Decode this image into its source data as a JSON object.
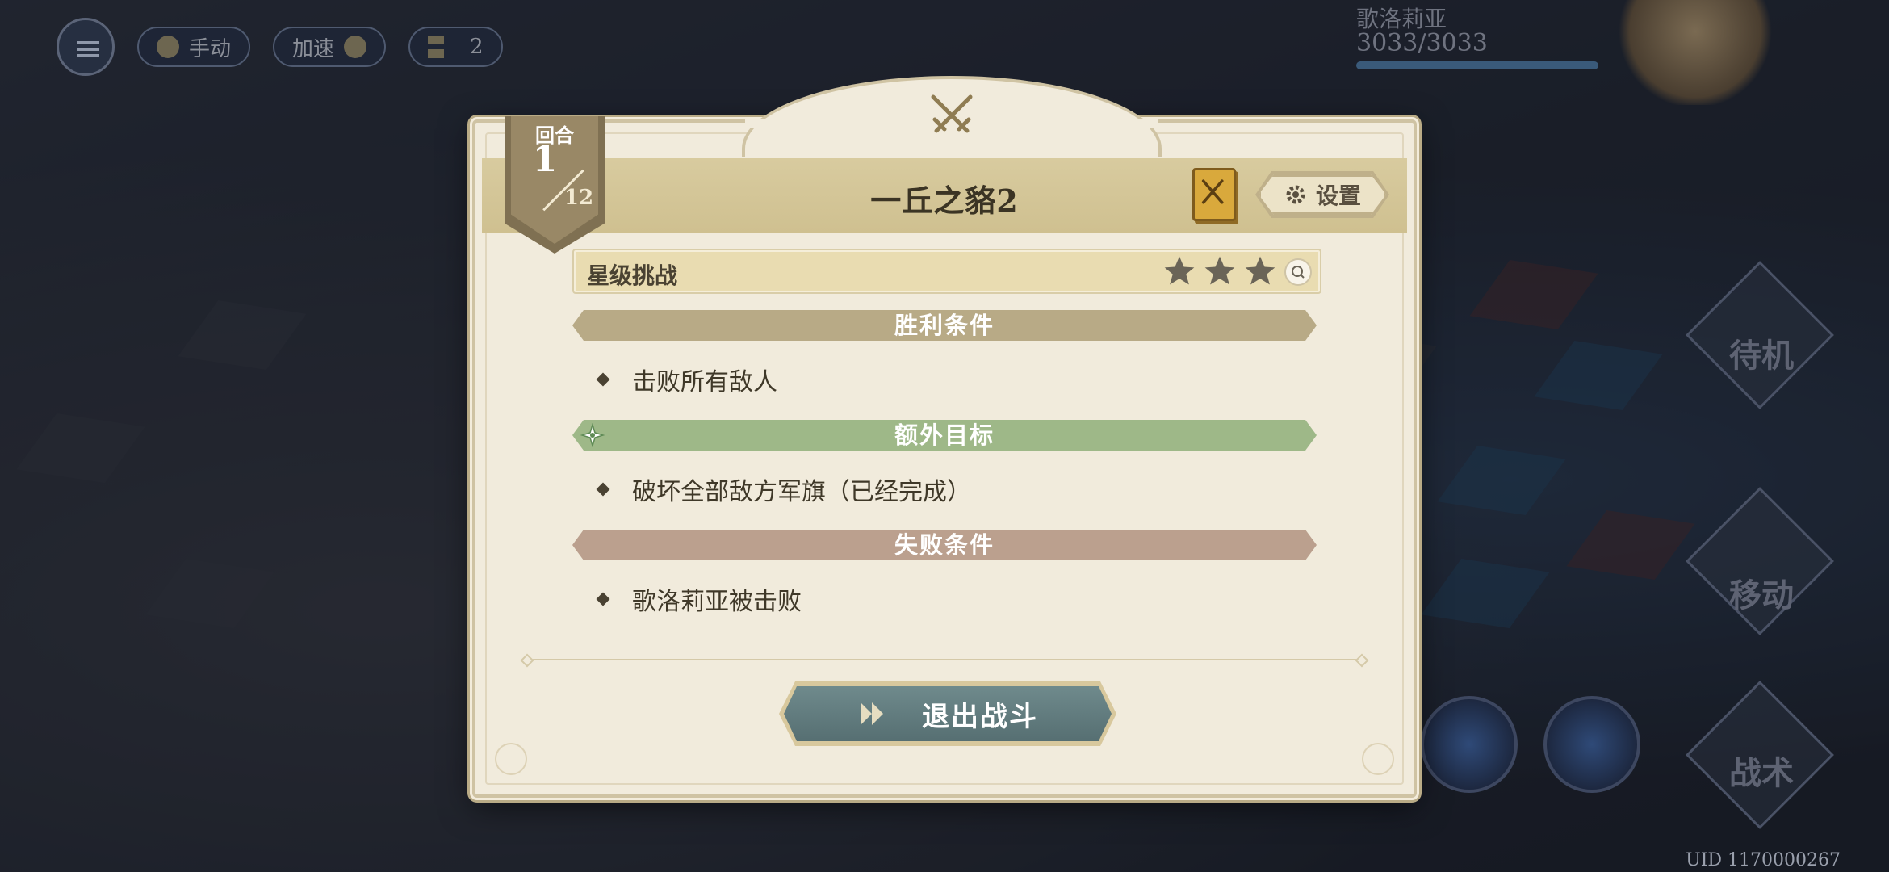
{
  "hud": {
    "mode_label": "手动",
    "speed_label": "加速",
    "timer_value": "2"
  },
  "character": {
    "name": "歌洛莉亚",
    "hp": "3033/3033"
  },
  "side_actions": {
    "wait_label": "待机",
    "move_label": "移动",
    "tactics_label": "战术"
  },
  "uid_text": "UID 1170000267",
  "dialog": {
    "title": "一丘之貉2",
    "turn": {
      "label": "回合",
      "current": "1",
      "total": "12"
    },
    "settings_label": "设置",
    "star_challenge": {
      "label": "星级挑战",
      "stars_earned": 3,
      "stars_total": 3
    },
    "sections": {
      "victory": {
        "title": "胜利条件",
        "item": "击败所有敌人"
      },
      "extra": {
        "title": "额外目标",
        "item": "破坏全部敌方军旗（已经完成）"
      },
      "defeat": {
        "title": "失败条件",
        "item": "歌洛莉亚被击败"
      }
    },
    "exit_label": "退出战斗"
  },
  "colors": {
    "panel_bg": "#f1ebdc",
    "title_bar": "#d8cb9f",
    "victory_bar": "#b8aa86",
    "extra_bar": "#9eb888",
    "defeat_bar": "#bba08e",
    "exit_button": "#6f8a8c",
    "badge": "#998866"
  },
  "icons": [
    "menu-icon",
    "hourglass-icon",
    "crossed-swords-icon",
    "book-icon",
    "gear-icon",
    "star-icon",
    "search-icon",
    "sparkle-icon",
    "diamond-bullet-icon",
    "play-arrows-icon"
  ]
}
